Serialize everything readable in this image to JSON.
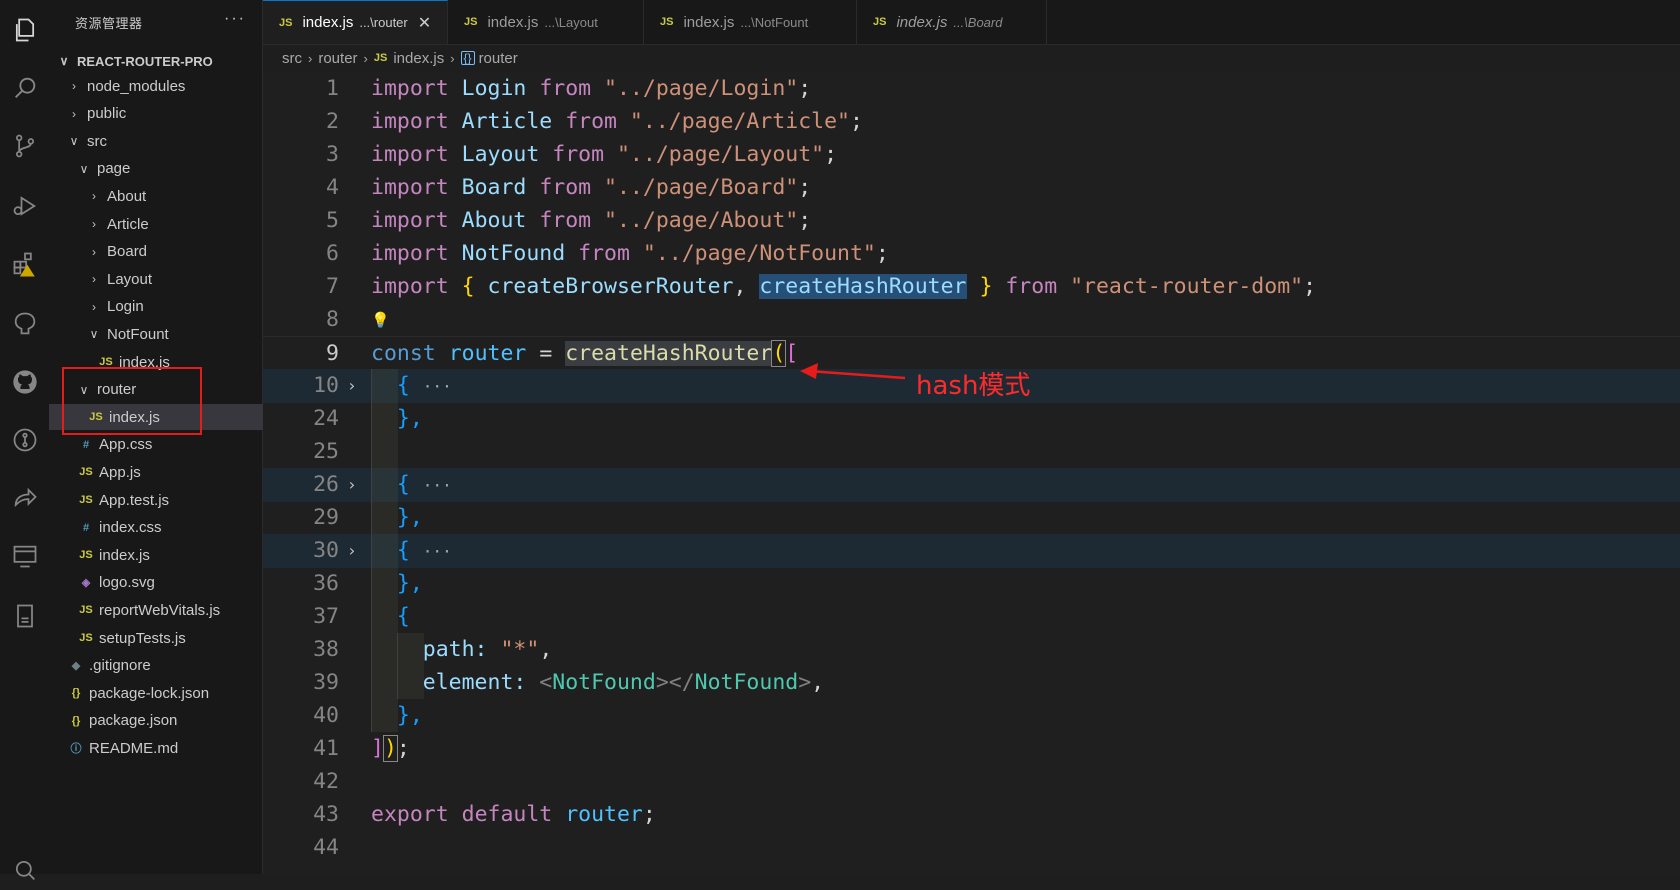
{
  "activity_bar": {
    "icons": [
      "explorer-icon",
      "search-icon",
      "source-control-icon",
      "run-debug-icon",
      "extensions-icon",
      "remote-icon",
      "github-icon",
      "gitlens-icon",
      "live-share-icon",
      "remote-explorer-icon",
      "bookmark-icon",
      "account-icon"
    ]
  },
  "sidebar": {
    "title": "资源管理器",
    "more": "···",
    "root": "REACT-ROUTER-PRO",
    "tree": [
      {
        "label": "node_modules",
        "type": "folder",
        "expanded": false
      },
      {
        "label": "public",
        "type": "folder",
        "expanded": false
      },
      {
        "label": "src",
        "type": "folder",
        "expanded": true
      },
      {
        "label": "page",
        "type": "folder",
        "expanded": true
      },
      {
        "label": "About",
        "type": "folder",
        "expanded": false
      },
      {
        "label": "Article",
        "type": "folder",
        "expanded": false
      },
      {
        "label": "Board",
        "type": "folder",
        "expanded": false
      },
      {
        "label": "Layout",
        "type": "folder",
        "expanded": false
      },
      {
        "label": "Login",
        "type": "folder",
        "expanded": false
      },
      {
        "label": "NotFount",
        "type": "folder",
        "expanded": true
      },
      {
        "label": "index.js",
        "type": "js"
      },
      {
        "label": "router",
        "type": "folder",
        "expanded": true
      },
      {
        "label": "index.js",
        "type": "js",
        "selected": true
      },
      {
        "label": "App.css",
        "type": "css"
      },
      {
        "label": "App.js",
        "type": "js"
      },
      {
        "label": "App.test.js",
        "type": "js"
      },
      {
        "label": "index.css",
        "type": "css"
      },
      {
        "label": "index.js",
        "type": "js"
      },
      {
        "label": "logo.svg",
        "type": "svg"
      },
      {
        "label": "reportWebVitals.js",
        "type": "js"
      },
      {
        "label": "setupTests.js",
        "type": "js"
      },
      {
        "label": ".gitignore",
        "type": "git"
      },
      {
        "label": "package-lock.json",
        "type": "json"
      },
      {
        "label": "package.json",
        "type": "json"
      },
      {
        "label": "README.md",
        "type": "info"
      }
    ],
    "icon_glyphs": {
      "js": "JS",
      "css": "#",
      "json": "{}",
      "svg": "◈",
      "git": "◆",
      "info": "ⓘ"
    }
  },
  "tabs": [
    {
      "name": "index.js",
      "desc": "...\\router",
      "active": true,
      "close": "✕"
    },
    {
      "name": "index.js",
      "desc": "...\\Layout",
      "active": false
    },
    {
      "name": "index.js",
      "desc": "...\\NotFount",
      "active": false
    },
    {
      "name": "index.js",
      "desc": "...\\Board",
      "active": false,
      "italic": true
    }
  ],
  "breadcrumb": {
    "parts": [
      "src",
      "router",
      "index.js",
      "router"
    ],
    "file_badge": "JS",
    "symbol_badge": "{}"
  },
  "editor": {
    "line_numbers": [
      "1",
      "2",
      "3",
      "4",
      "5",
      "6",
      "7",
      "8",
      "9",
      "10",
      "24",
      "25",
      "26",
      "29",
      "30",
      "36",
      "37",
      "38",
      "39",
      "40",
      "41",
      "42",
      "43",
      "44"
    ],
    "current_line": "9",
    "l1": {
      "kw": "import",
      "name": "Login",
      "from": "from",
      "path": "\"../page/Login\"",
      "semi": ";"
    },
    "l2": {
      "kw": "import",
      "name": "Article",
      "from": "from",
      "path": "\"../page/Article\"",
      "semi": ";"
    },
    "l3": {
      "kw": "import",
      "name": "Layout",
      "from": "from",
      "path": "\"../page/Layout\"",
      "semi": ";"
    },
    "l4": {
      "kw": "import",
      "name": "Board",
      "from": "from",
      "path": "\"../page/Board\"",
      "semi": ";"
    },
    "l5": {
      "kw": "import",
      "name": "About",
      "from": "from",
      "path": "\"../page/About\"",
      "semi": ";"
    },
    "l6": {
      "kw": "import",
      "name": "NotFound",
      "from": "from",
      "path": "\"../page/NotFount\"",
      "semi": ";"
    },
    "l7": {
      "kw": "import",
      "ob": "{",
      "a": "createBrowserRouter",
      "comma": ",",
      "b": "createHashRouter",
      "cb": "}",
      "from": "from",
      "path": "\"react-router-dom\"",
      "semi": ";"
    },
    "l9": {
      "kw": "const",
      "name": "router",
      "eq": "=",
      "fn": "createHashRouter",
      "paren": "(",
      "bracket": "["
    },
    "fold_open": "{",
    "fold_ellipsis": "···",
    "fold_close": "},",
    "l37": "{",
    "l38": {
      "key": "path:",
      "val": "\"*\"",
      "comma": ","
    },
    "l39": {
      "key": "element:",
      "lt": "<",
      "tag": "NotFound",
      "gt": ">",
      "lt2": "</",
      "tag2": "NotFound",
      "gt2": ">",
      "comma": ","
    },
    "l40": "},",
    "l41": {
      "bracket": "]",
      "paren": ")",
      "semi": ";"
    },
    "l43": {
      "export": "export",
      "default": "default",
      "name": "router",
      "semi": ";"
    },
    "lightbulb": "💡"
  },
  "annotation": {
    "text": "hash模式",
    "color": "#ff2a2a"
  }
}
